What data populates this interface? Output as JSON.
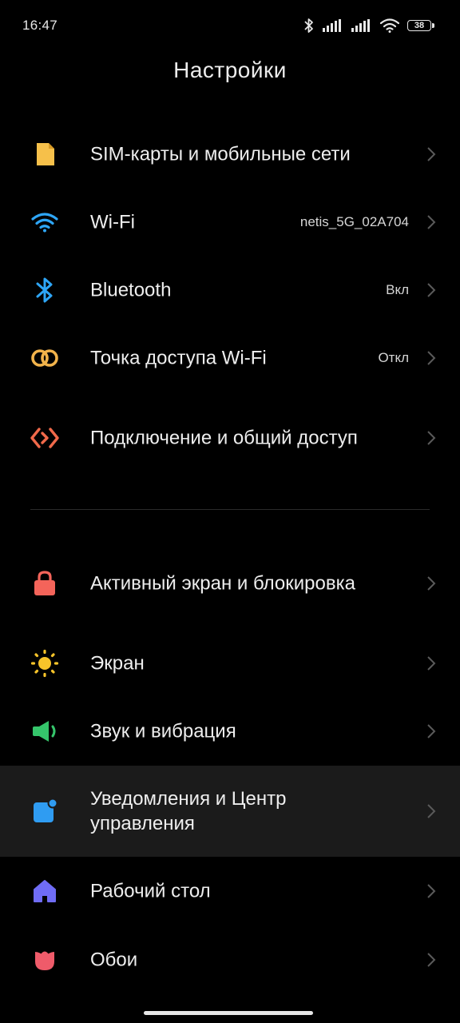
{
  "status_bar": {
    "time": "16:47",
    "battery": "38",
    "icons": [
      "bluetooth-icon",
      "signal-icon",
      "signal-icon",
      "wifi-icon",
      "battery-icon"
    ]
  },
  "header": {
    "title": "Настройки"
  },
  "settings": [
    {
      "label": "SIM-карты и мобильные сети",
      "value": "",
      "icon": "sim-card-icon",
      "color": "#f6c04a"
    },
    {
      "label": "Wi-Fi",
      "value": "netis_5G_02A704",
      "icon": "wifi-icon",
      "color": "#2ea6f7"
    },
    {
      "label": "Bluetooth",
      "value": "Вкл",
      "icon": "bluetooth-icon",
      "color": "#2ea6f7"
    },
    {
      "label": "Точка доступа Wi-Fi",
      "value": "Откл",
      "icon": "hotspot-icon",
      "color": "#f2b34b"
    },
    {
      "label": "Подключение и общий доступ",
      "value": "",
      "icon": "share-icon",
      "color": "#f0694a"
    },
    {
      "label": "Активный экран и блокировка",
      "value": "",
      "icon": "lock-icon",
      "color": "#f4645a"
    },
    {
      "label": "Экран",
      "value": "",
      "icon": "sun-icon",
      "color": "#f7c42a"
    },
    {
      "label": "Звук и вибрация",
      "value": "",
      "icon": "speaker-icon",
      "color": "#35c56b"
    },
    {
      "label": "Уведомления и Центр управления",
      "value": "",
      "icon": "notification-icon",
      "color": "#2f9cf2"
    },
    {
      "label": "Рабочий стол",
      "value": "",
      "icon": "home-icon",
      "color": "#6f6cf5"
    },
    {
      "label": "Обои",
      "value": "",
      "icon": "tulip-icon",
      "color": "#ef5b6a"
    }
  ],
  "highlighted_item": "Уведомления и Центр управления"
}
